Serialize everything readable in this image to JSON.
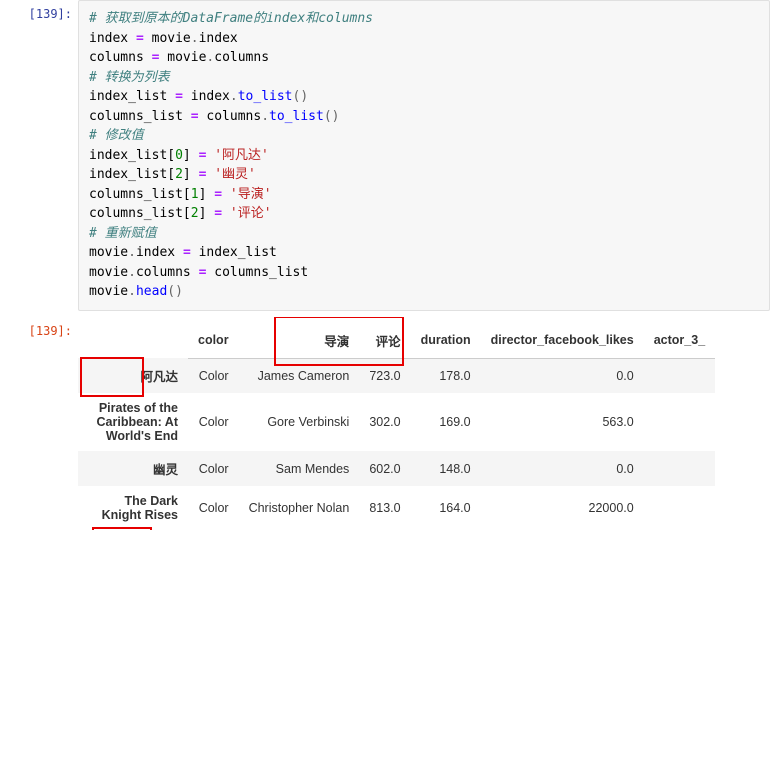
{
  "input_prompt": "[139]:",
  "output_prompt": "[139]:",
  "code": {
    "c1": "# 获取到原本的DataFrame的index和columns",
    "l2a": "index ",
    "l2b": "=",
    "l2c": " movie",
    "l2d": ".",
    "l2e": "index",
    "l3a": "columns ",
    "l3b": "=",
    "l3c": " movie",
    "l3d": ".",
    "l3e": "columns",
    "c2": "# 转换为列表",
    "l5a": "index_list ",
    "l5b": "=",
    "l5c": " index",
    "l5d": ".",
    "l5e": "to_list",
    "l5f": "()",
    "l6a": "columns_list ",
    "l6b": "=",
    "l6c": " columns",
    "l6d": ".",
    "l6e": "to_list",
    "l6f": "()",
    "c3": "# 修改值",
    "l8a": "index_list[",
    "l8b": "0",
    "l8c": "] ",
    "l8d": "=",
    "l8e": " ",
    "l8f": "'阿凡达'",
    "l9a": "index_list[",
    "l9b": "2",
    "l9c": "] ",
    "l9d": "=",
    "l9e": " ",
    "l9f": "'幽灵'",
    "l10a": "columns_list[",
    "l10b": "1",
    "l10c": "] ",
    "l10d": "=",
    "l10e": " ",
    "l10f": "'导演'",
    "l11a": "columns_list[",
    "l11b": "2",
    "l11c": "] ",
    "l11d": "=",
    "l11e": " ",
    "l11f": "'评论'",
    "c4": "# 重新赋值",
    "l13a": "movie",
    "l13b": ".",
    "l13c": "index ",
    "l13d": "=",
    "l13e": " index_list",
    "l14a": "movie",
    "l14b": ".",
    "l14c": "columns ",
    "l14d": "=",
    "l14e": " columns_list",
    "l15a": "movie",
    "l15b": ".",
    "l15c": "head",
    "l15d": "()"
  },
  "table": {
    "columns": [
      "color",
      "导演",
      "评论",
      "duration",
      "director_facebook_likes",
      "actor_3_"
    ],
    "rows": [
      {
        "idx": "阿凡达",
        "cells": [
          "Color",
          "James Cameron",
          "723.0",
          "178.0",
          "0.0",
          ""
        ]
      },
      {
        "idx": "Pirates of the Caribbean: At World's End",
        "cells": [
          "Color",
          "Gore Verbinski",
          "302.0",
          "169.0",
          "563.0",
          ""
        ]
      },
      {
        "idx": "幽灵",
        "cells": [
          "Color",
          "Sam Mendes",
          "602.0",
          "148.0",
          "0.0",
          ""
        ]
      },
      {
        "idx": "The Dark Knight Rises",
        "cells": [
          "Color",
          "Christopher Nolan",
          "813.0",
          "164.0",
          "22000.0",
          ""
        ]
      }
    ]
  }
}
